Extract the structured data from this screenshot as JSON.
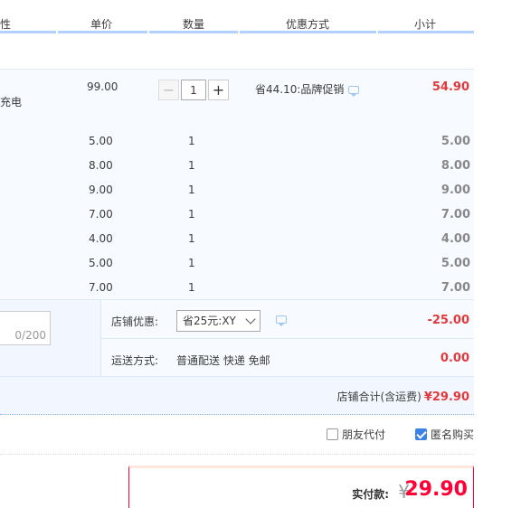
{
  "header": {
    "columns": [
      "性",
      "单价",
      "数量",
      "优惠方式",
      "小计"
    ]
  },
  "item_main": {
    "name_fragment": "充电",
    "price": "99.00",
    "quantity": "1",
    "promo": "省44.10:品牌促销",
    "subtotal": "54.90"
  },
  "items": [
    {
      "price": "5.00",
      "qty": "1",
      "subtotal": "5.00"
    },
    {
      "price": "8.00",
      "qty": "1",
      "subtotal": "8.00"
    },
    {
      "price": "9.00",
      "qty": "1",
      "subtotal": "9.00"
    },
    {
      "price": "7.00",
      "qty": "1",
      "subtotal": "7.00"
    },
    {
      "price": "4.00",
      "qty": "1",
      "subtotal": "4.00"
    },
    {
      "price": "5.00",
      "qty": "1",
      "subtotal": "5.00"
    },
    {
      "price": "7.00",
      "qty": "1",
      "subtotal": "7.00"
    }
  ],
  "message": {
    "counter": "0/200"
  },
  "shop_discount": {
    "label": "店铺优惠:",
    "selected": "省25元:XY",
    "amount": "-25.00"
  },
  "shipping": {
    "label": "运送方式:",
    "value": "普通配送 快递 免邮",
    "fee": "0.00"
  },
  "shop_total": {
    "label": "店铺合计(含运费)",
    "amount": "¥29.90"
  },
  "options": {
    "friend_pay": "朋友代付",
    "friend_pay_checked": false,
    "anonymous": "匿名购买",
    "anonymous_checked": true
  },
  "payment": {
    "label": "实付款:",
    "currency": "¥",
    "amount": "29.90"
  },
  "colors": {
    "accent_red": "#ff0036",
    "price_red": "#e4393c",
    "header_border": "#b2d1ff",
    "row_bg": "#f7faff"
  }
}
